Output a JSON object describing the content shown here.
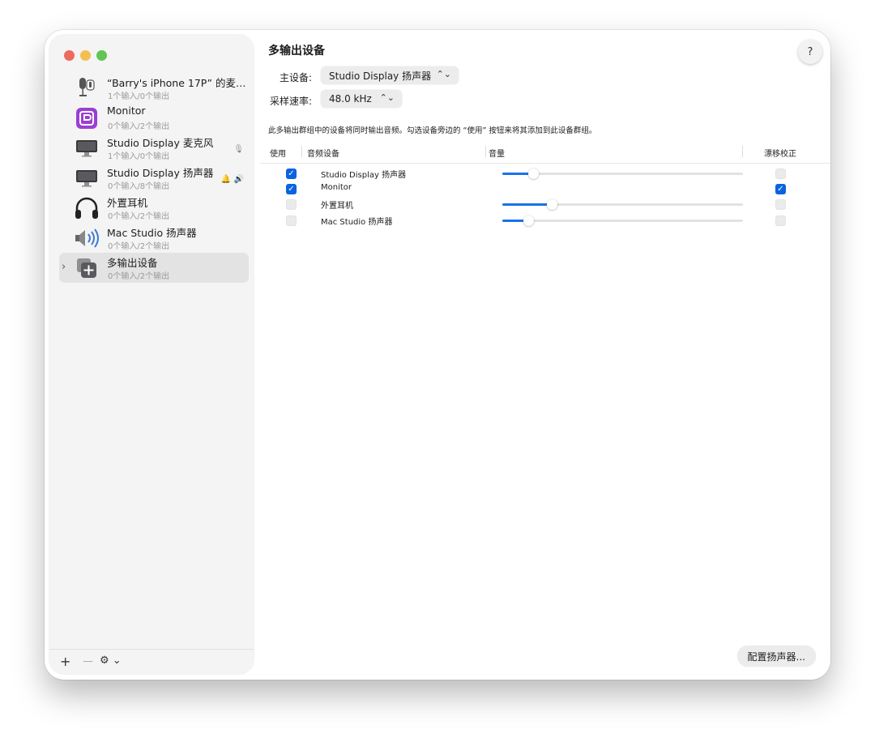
{
  "sidebar": {
    "devices": [
      {
        "name": "“Barry's iPhone 17P” 的麦…",
        "sub": "1个输入/0个输出",
        "icon": "microphone-iphone-icon",
        "right": "",
        "expand": ""
      },
      {
        "name": "Monitor",
        "sub": "0个输入/2个输出",
        "icon": "monitor-app-icon",
        "right": "",
        "expand": ""
      },
      {
        "name": "Studio Display 麦克风",
        "sub": "1个输入/0个输出",
        "icon": "display-icon",
        "right": "🎙",
        "expand": ""
      },
      {
        "name": "Studio Display 扬声器",
        "sub": "0个输入/8个输出",
        "icon": "display-icon",
        "right": "🔔 🔊",
        "expand": ""
      },
      {
        "name": "外置耳机",
        "sub": "0个输入/2个输出",
        "icon": "headphones-icon",
        "right": "",
        "expand": ""
      },
      {
        "name": "Mac Studio 扬声器",
        "sub": "0个输入/2个输出",
        "icon": "speaker-icon",
        "right": "",
        "expand": ""
      },
      {
        "name": "多输出设备",
        "sub": "0个输入/2个输出",
        "icon": "multi-output-icon",
        "right": "",
        "expand": "›"
      }
    ],
    "bottom": {
      "add": "+",
      "remove": "—",
      "gear": "⚙︎ ⌄"
    }
  },
  "main": {
    "title": "多输出设备",
    "help": "?",
    "primary_label": "主设备:",
    "primary_value": "Studio Display 扬声器",
    "rate_label": "采样速率:",
    "rate_value": "48.0 kHz",
    "popup_arrow": "⌃⌄",
    "description": "此多输出群组中的设备将同时输出音频。勾选设备旁边的 “使用” 按钮来将其添加到此设备群组。",
    "columns": {
      "use": "使用",
      "device": "音频设备",
      "volume": "音量",
      "drift": "漂移校正"
    },
    "rows": [
      {
        "name": "Studio Display 扬声器",
        "use": true,
        "volume": 0.12,
        "drift": false,
        "has_volume": true
      },
      {
        "name": "Monitor",
        "use": true,
        "volume": 0,
        "drift": true,
        "has_volume": false
      },
      {
        "name": "外置耳机",
        "use": false,
        "volume": 0.2,
        "drift": false,
        "has_volume": true
      },
      {
        "name": "Mac Studio 扬声器",
        "use": false,
        "volume": 0.1,
        "drift": false,
        "has_volume": true
      }
    ],
    "config_button": "配置扬声器..."
  },
  "colors": {
    "accent": "#1b72e8",
    "checkbox_on": "#0a63e0",
    "red": "#ed6a5e",
    "yellow": "#f5bf4f",
    "green": "#61c554"
  }
}
